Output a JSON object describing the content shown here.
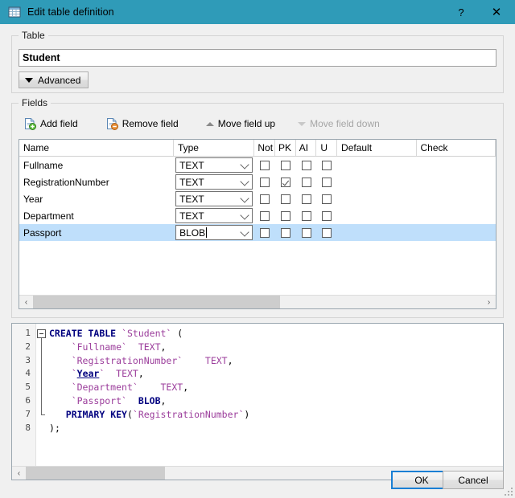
{
  "titlebar": {
    "icon": "table-grid-icon",
    "title": "Edit table definition",
    "help_label": "?",
    "close_label": "✕"
  },
  "table_group": {
    "legend": "Table",
    "name_value": "Student",
    "name_placeholder": "",
    "advanced_label": "Advanced"
  },
  "fields_group": {
    "legend": "Fields",
    "toolbar": {
      "add_field": "Add field",
      "remove_field": "Remove field",
      "move_field_up": "Move field up",
      "move_field_down": "Move field down"
    },
    "columns": [
      "Name",
      "Type",
      "Not",
      "PK",
      "AI",
      "U",
      "Default",
      "Check"
    ],
    "rows": [
      {
        "name": "Fullname",
        "type": "TEXT",
        "not": false,
        "pk": false,
        "ai": false,
        "u": false,
        "default": "",
        "check": "",
        "selected": false,
        "editing": false
      },
      {
        "name": "RegistrationNumber",
        "type": "TEXT",
        "not": false,
        "pk": true,
        "ai": false,
        "u": false,
        "default": "",
        "check": "",
        "selected": false,
        "editing": false
      },
      {
        "name": "Year",
        "type": "TEXT",
        "not": false,
        "pk": false,
        "ai": false,
        "u": false,
        "default": "",
        "check": "",
        "selected": false,
        "editing": false
      },
      {
        "name": "Department",
        "type": "TEXT",
        "not": false,
        "pk": false,
        "ai": false,
        "u": false,
        "default": "",
        "check": "",
        "selected": false,
        "editing": false
      },
      {
        "name": "Passport",
        "type": "BLOB",
        "not": false,
        "pk": false,
        "ai": false,
        "u": false,
        "default": "",
        "check": "",
        "selected": true,
        "editing": true
      }
    ],
    "scrollbar": {
      "left_arrow": "‹",
      "right_arrow": "›",
      "thumb_percent": 55
    }
  },
  "sql_editor": {
    "line_numbers": [
      "1",
      "2",
      "3",
      "4",
      "5",
      "6",
      "7",
      "8"
    ],
    "lines": [
      "CREATE TABLE `Student` (",
      "    `Fullname`  TEXT,",
      "    `RegistrationNumber`    TEXT,",
      "    `Year`  TEXT,",
      "    `Department`    TEXT,",
      "    `Passport`  BLOB,",
      "   PRIMARY KEY(`RegistrationNumber`)",
      ");"
    ],
    "scrollbar": {
      "left_arrow": "‹",
      "right_arrow": "›",
      "thumb_percent": 30
    }
  },
  "footer": {
    "ok_label": "OK",
    "cancel_label": "Cancel"
  },
  "colors": {
    "titlebar_bg": "#2f9bb8",
    "dialog_bg": "#f0f0f0",
    "selection_row": "#bfdffb",
    "focus_border": "#1a7fd4",
    "sql_keyword": "#00007f",
    "sql_identifier": "#9b3d9b"
  }
}
